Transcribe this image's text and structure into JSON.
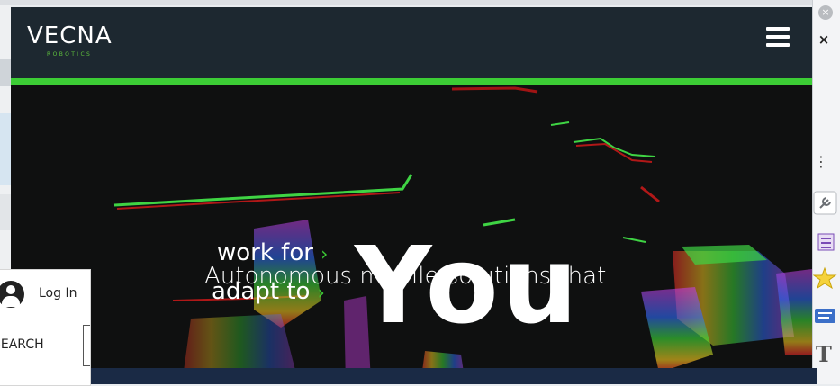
{
  "brand": {
    "name": "VECNA",
    "sub": "ROBOTICS",
    "accent": "#3ccd35",
    "header_bg": "#1d2830"
  },
  "header": {
    "menu_icon": "hamburger-icon"
  },
  "hero": {
    "tagline": "Autonomous mobile solutions that",
    "rotating": [
      {
        "text": "work for",
        "chevron": "›"
      },
      {
        "text": "adapt to",
        "chevron": "›"
      }
    ],
    "big_word": "You"
  },
  "overlay": {
    "login_label": "Log In",
    "search_label": "SEARCH",
    "avatar_icon": "user-avatar-icon"
  },
  "browser": {
    "close_label": "×",
    "circle_close_label": "×",
    "kebab_label": "⋮",
    "side_icons": [
      "wrench-icon",
      "list-icon",
      "star-icon",
      "comment-icon",
      "text-icon"
    ]
  }
}
